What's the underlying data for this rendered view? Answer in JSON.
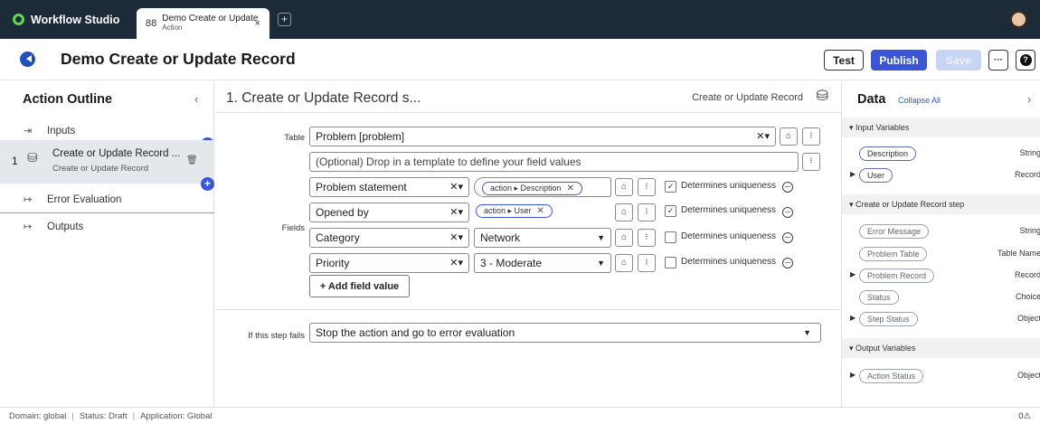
{
  "app": {
    "name": "Workflow Studio"
  },
  "tab": {
    "title": "Demo Create or Update",
    "subtitle": "Action",
    "close": "×",
    "add": "+"
  },
  "header": {
    "title": "Demo Create or Update Record",
    "buttons": {
      "test": "Test",
      "publish": "Publish",
      "save": "Save",
      "more": "···",
      "help": "?"
    }
  },
  "outline": {
    "title": "Action Outline",
    "collapse": "‹",
    "inputs": "Inputs",
    "step": {
      "number": "1",
      "title": "Create or Update Record ...",
      "subtitle": "Create or Update Record"
    },
    "error_evaluation": "Error Evaluation",
    "outputs": "Outputs"
  },
  "step": {
    "heading": "1.  Create or Update Record s...",
    "type": "Create or Update Record",
    "table_label": "Table",
    "table_value": "Problem [problem]",
    "template_placeholder": "(Optional) Drop in a template to define your field values",
    "fields_label": "Fields",
    "fields": [
      {
        "name": "Problem statement",
        "pill": "action ▸ Description",
        "checked": true,
        "unique_label": "Determines uniqueness"
      },
      {
        "name": "Opened by",
        "pill": "action ▸ User",
        "checked": true,
        "unique_label": "Determines uniqueness"
      },
      {
        "name": "Category",
        "value": "Network",
        "checked": false,
        "unique_label": "Determines uniqueness"
      },
      {
        "name": "Priority",
        "value": "3 - Moderate",
        "checked": false,
        "unique_label": "Determines uniqueness"
      }
    ],
    "add_field": "+ Add field value",
    "fail_label": "If this step fails",
    "fail_value": "Stop the action and go to error evaluation"
  },
  "data_panel": {
    "title": "Data",
    "collapse_all": "Collapse All",
    "chevron": "›",
    "sections": [
      {
        "title": "Input Variables",
        "vars": [
          {
            "name": "Description",
            "type": "String",
            "expandable": false,
            "active": true
          },
          {
            "name": "User",
            "type": "Record",
            "expandable": true,
            "active": true
          }
        ]
      },
      {
        "title": "Create or Update Record step",
        "vars": [
          {
            "name": "Error Message",
            "type": "String",
            "expandable": false,
            "active": false
          },
          {
            "name": "Problem Table",
            "type": "Table Name",
            "expandable": false,
            "active": false
          },
          {
            "name": "Problem Record",
            "type": "Record",
            "expandable": true,
            "active": false
          },
          {
            "name": "Status",
            "type": "Choice",
            "expandable": false,
            "active": false
          },
          {
            "name": "Step Status",
            "type": "Object",
            "expandable": true,
            "active": false
          }
        ]
      },
      {
        "title": "Output Variables",
        "vars": [
          {
            "name": "Action Status",
            "type": "Object",
            "expandable": true,
            "active": false
          }
        ]
      }
    ]
  },
  "footer": {
    "domain": "Domain: global",
    "status": "Status: Draft",
    "application": "Application: Global",
    "warnings": "0⚠"
  },
  "colors": {
    "topbar": "#1d2b39",
    "accent": "#3a55d8",
    "brand_green": "#62d84e"
  },
  "icons": [
    "workflow-studio-logo-icon",
    "action-tab-icon",
    "back-arrow-icon",
    "inputs-icon",
    "step-icon",
    "trash-icon",
    "error-evaluation-icon",
    "outputs-icon",
    "data-pill-picker-icon",
    "script-icon",
    "minus-circle-icon",
    "caret-down-icon"
  ]
}
